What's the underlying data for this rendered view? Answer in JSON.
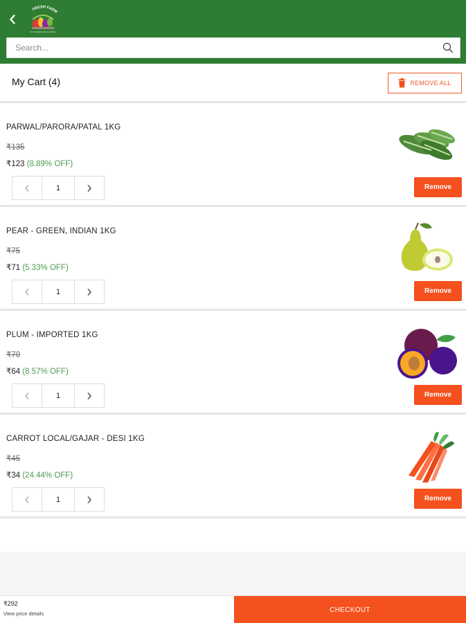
{
  "header": {
    "back_icon": "chevron-left-icon",
    "logo_text": "FRESH FARM",
    "logo_tagline": "Your Organic Grocery Store",
    "brand_color": "#2e7d32"
  },
  "search": {
    "placeholder": "Search...",
    "icon": "search-icon"
  },
  "cart": {
    "title": "My Cart (4)",
    "remove_all_label": "REMOVE ALL",
    "remove_all_icon": "trash-icon",
    "accent_color": "#f4511e"
  },
  "items": [
    {
      "name": "PARWAL/PARORA/PATAL 1KG",
      "mrp": "₹135",
      "price": "₹123",
      "discount": "(8.89% OFF)",
      "quantity": "1",
      "remove_label": "Remove",
      "image": "pointed-gourd-image"
    },
    {
      "name": "PEAR - GREEN, INDIAN 1KG",
      "mrp": "₹75",
      "price": "₹71",
      "discount": "(5.33% OFF)",
      "quantity": "1",
      "remove_label": "Remove",
      "image": "pear-image"
    },
    {
      "name": "PLUM - IMPORTED 1KG",
      "mrp": "₹70",
      "price": "₹64",
      "discount": "(8.57% OFF)",
      "quantity": "1",
      "remove_label": "Remove",
      "image": "plum-image"
    },
    {
      "name": "CARROT LOCAL/GAJAR - DESI 1KG",
      "mrp": "₹45",
      "price": "₹34",
      "discount": "(24.44% OFF)",
      "quantity": "1",
      "remove_label": "Remove",
      "image": "carrot-image"
    }
  ],
  "footer": {
    "total": "₹292",
    "price_details_link": "View price details",
    "checkout_label": "CHECKOUT"
  }
}
